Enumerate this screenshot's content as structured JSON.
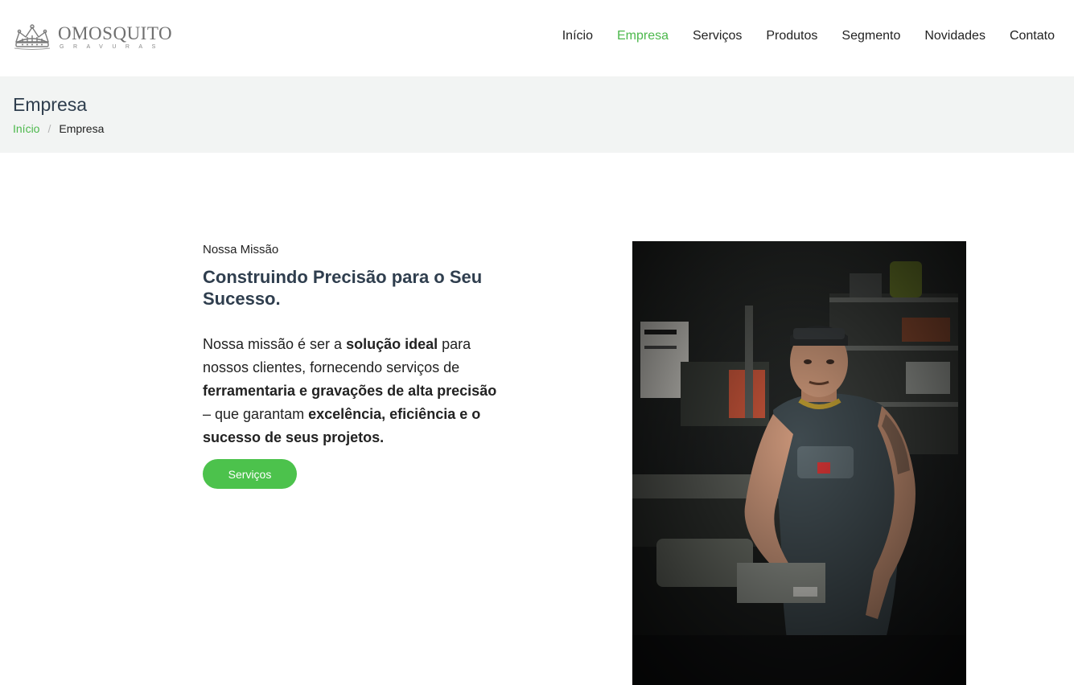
{
  "brand": {
    "name": "OMOSQUITO",
    "tagline": "GRAVURAS",
    "logo_icon": "crown-icon"
  },
  "nav": {
    "items": [
      {
        "label": "Início",
        "active": false
      },
      {
        "label": "Empresa",
        "active": true
      },
      {
        "label": "Serviços",
        "active": false
      },
      {
        "label": "Produtos",
        "active": false
      },
      {
        "label": "Segmento",
        "active": false
      },
      {
        "label": "Novidades",
        "active": false
      },
      {
        "label": "Contato",
        "active": false
      }
    ]
  },
  "page_header": {
    "title": "Empresa",
    "breadcrumb": {
      "home": "Início",
      "separator": "/",
      "current": "Empresa"
    }
  },
  "mission": {
    "eyebrow": "Nossa Missão",
    "title": "Construindo Precisão para o Seu Sucesso.",
    "text_1": "Nossa missão é ser a ",
    "bold_1": "solução ideal",
    "text_2": " para nossos clientes, fornecendo serviços de ",
    "bold_2": "ferramentaria e gravações de alta precisão",
    "text_3": " – que garantam ",
    "bold_3": "excelência, eficiência e o sucesso de seus projetos.",
    "button_label": "Serviços"
  },
  "photo": {
    "subject": "workshop-worker-photo"
  },
  "colors": {
    "accent": "#4cb84c",
    "button": "#4cc24c",
    "title_band": "#f2f4f3",
    "heading": "#2f3e4e"
  }
}
